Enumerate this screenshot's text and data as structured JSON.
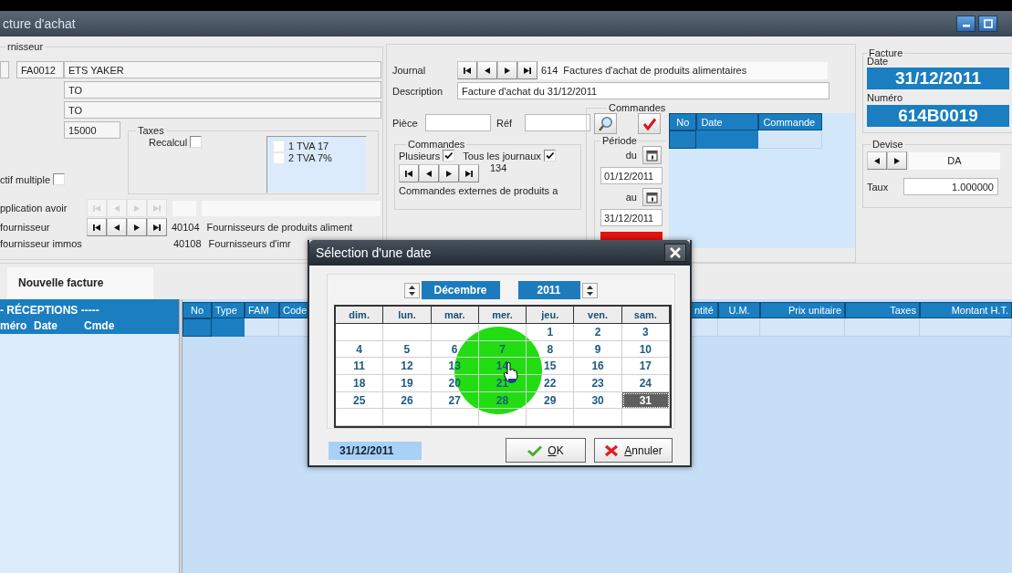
{
  "window": {
    "title": "cture d'achat"
  },
  "supplier": {
    "legend": "rnisseur",
    "code": "FA0012",
    "name": "ETS YAKER",
    "address_1": "TO",
    "address_2": "TO",
    "postal_code": "15000",
    "taxes": {
      "legend": "Taxes",
      "recalc_label": "Recalcul",
      "recalc_checked": false,
      "items": [
        {
          "label": "1 TVA 17",
          "checked": false
        },
        {
          "label": "2 TVA 7%",
          "checked": false
        }
      ]
    },
    "multiple": {
      "label": "ctif multiple",
      "checked": false
    },
    "credit": {
      "label": "pplication avoir",
      "disabled": true
    },
    "accounts": [
      {
        "kind": "nav",
        "label": "fournisseur",
        "number": "40104",
        "name": "Fournisseurs de produits aliment"
      },
      {
        "kind": "plain",
        "label": "fournisseur immos",
        "number": "40108",
        "name": "Fournisseurs d'imr"
      }
    ]
  },
  "journal": {
    "label": "Journal",
    "number": "614",
    "name": "Factures d'achat de produits alimentaires",
    "description_label": "Description",
    "description": "Facture d'achat du 31/12/2011",
    "piece_label": "Pièce",
    "ref_label": "Réf",
    "orders": {
      "legend": "Commandes",
      "several": {
        "label": "Plusieurs",
        "checked": true
      },
      "all_journals": {
        "label": "Tous les journaux",
        "checked": true
      },
      "number": "134",
      "name": "Commandes externes de produits a"
    }
  },
  "orders_panel": {
    "legend": "Commandes",
    "period_label": "Période",
    "from_label": "du",
    "from": "01/12/2011",
    "to_label": "au",
    "to": "31/12/2011",
    "columns": [
      "No",
      "Date",
      "Commande"
    ]
  },
  "invoice": {
    "legend": "Facture",
    "date_label": "Date",
    "date": "31/12/2011",
    "number_label": "Numéro",
    "number": "614B0019"
  },
  "currency": {
    "legend": "Devise",
    "code": "DA",
    "rate_label": "Taux",
    "rate": "1.000000"
  },
  "tabs": [
    {
      "label": "Nouvelle facture",
      "selected": true
    }
  ],
  "receptions": {
    "title": "- RÉCEPTIONS -----",
    "columns": [
      "méro",
      "Date",
      "Cmde"
    ]
  },
  "lines": {
    "columns": [
      "No",
      "Type",
      "FAM",
      "Code",
      "ntité",
      "U.M.",
      "Prix unitaire",
      "Taxes",
      "Montant H.T."
    ]
  },
  "date_dialog": {
    "title": "Sélection d'une date",
    "month": "Décembre",
    "year": "2011",
    "weekdays": [
      "dim.",
      "lun.",
      "mar.",
      "mer.",
      "jeu.",
      "ven.",
      "sam."
    ],
    "weeks": [
      [
        {
          "kind": "blank"
        },
        {
          "kind": "blank"
        },
        {
          "kind": "blank"
        },
        {
          "kind": "blank"
        },
        {
          "kind": "day",
          "day": "1",
          "selected": false
        },
        {
          "kind": "day",
          "day": "2",
          "selected": false
        },
        {
          "kind": "day",
          "day": "3",
          "selected": false
        }
      ],
      [
        {
          "kind": "day",
          "day": "4",
          "selected": false
        },
        {
          "kind": "day",
          "day": "5",
          "selected": false
        },
        {
          "kind": "day",
          "day": "6",
          "selected": false
        },
        {
          "kind": "day",
          "day": "7",
          "selected": false
        },
        {
          "kind": "day",
          "day": "8",
          "selected": false
        },
        {
          "kind": "day",
          "day": "9",
          "selected": false
        },
        {
          "kind": "day",
          "day": "10",
          "selected": false
        }
      ],
      [
        {
          "kind": "day",
          "day": "11",
          "selected": false
        },
        {
          "kind": "day",
          "day": "12",
          "selected": false
        },
        {
          "kind": "day",
          "day": "13",
          "selected": false
        },
        {
          "kind": "day",
          "day": "14",
          "selected": false
        },
        {
          "kind": "day",
          "day": "15",
          "selected": false
        },
        {
          "kind": "day",
          "day": "16",
          "selected": false
        },
        {
          "kind": "day",
          "day": "17",
          "selected": false
        }
      ],
      [
        {
          "kind": "day",
          "day": "18",
          "selected": false
        },
        {
          "kind": "day",
          "day": "19",
          "selected": false
        },
        {
          "kind": "day",
          "day": "20",
          "selected": false
        },
        {
          "kind": "day",
          "day": "21",
          "selected": false
        },
        {
          "kind": "day",
          "day": "22",
          "selected": false
        },
        {
          "kind": "day",
          "day": "23",
          "selected": false
        },
        {
          "kind": "day",
          "day": "24",
          "selected": false
        }
      ],
      [
        {
          "kind": "day",
          "day": "25",
          "selected": false
        },
        {
          "kind": "day",
          "day": "26",
          "selected": false
        },
        {
          "kind": "day",
          "day": "27",
          "selected": false
        },
        {
          "kind": "day",
          "day": "28",
          "selected": false
        },
        {
          "kind": "day",
          "day": "29",
          "selected": false
        },
        {
          "kind": "day",
          "day": "30",
          "selected": false
        },
        {
          "kind": "day",
          "day": "31",
          "selected": true
        }
      ],
      [
        {
          "kind": "blank"
        },
        {
          "kind": "blank"
        },
        {
          "kind": "blank"
        },
        {
          "kind": "blank"
        },
        {
          "kind": "blank"
        },
        {
          "kind": "blank"
        },
        {
          "kind": "blank"
        }
      ]
    ],
    "value": "31/12/2011",
    "ok": "OK",
    "cancel": "Annuler"
  }
}
